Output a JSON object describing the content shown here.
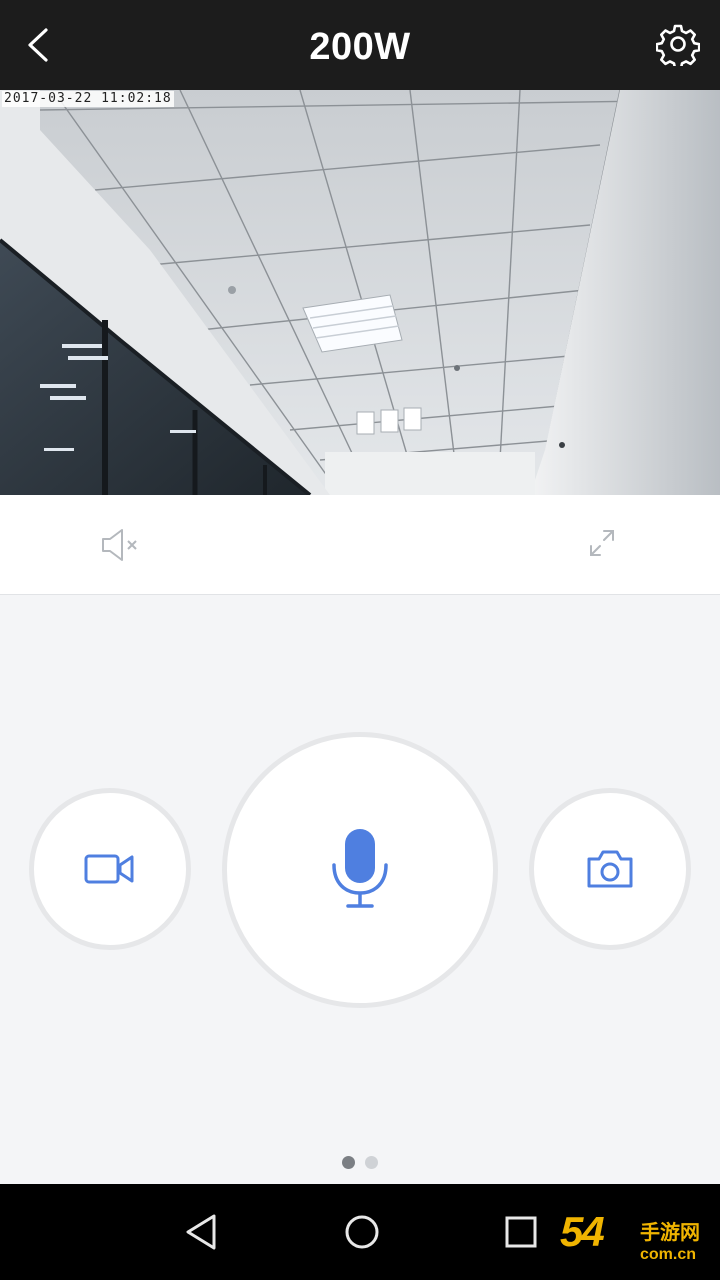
{
  "header": {
    "title": "200W",
    "back_icon": "chevron-left-icon",
    "settings_icon": "gear-icon"
  },
  "video": {
    "timestamp": "2017-03-22 11:02:18"
  },
  "control_bar": {
    "mute_icon": "speaker-muted-icon",
    "fullscreen_icon": "expand-icon"
  },
  "controls": {
    "record_icon": "video-camera-icon",
    "talk_icon": "microphone-icon",
    "snapshot_icon": "camera-icon",
    "accent_color": "#4f7fe0",
    "page_count": 2,
    "active_page": 1
  },
  "navbar": {
    "back_icon": "triangle-back-icon",
    "home_icon": "circle-home-icon",
    "recent_icon": "square-recents-icon"
  },
  "watermark": {
    "number": "54",
    "name": "手游网",
    "domain": "com.cn"
  }
}
